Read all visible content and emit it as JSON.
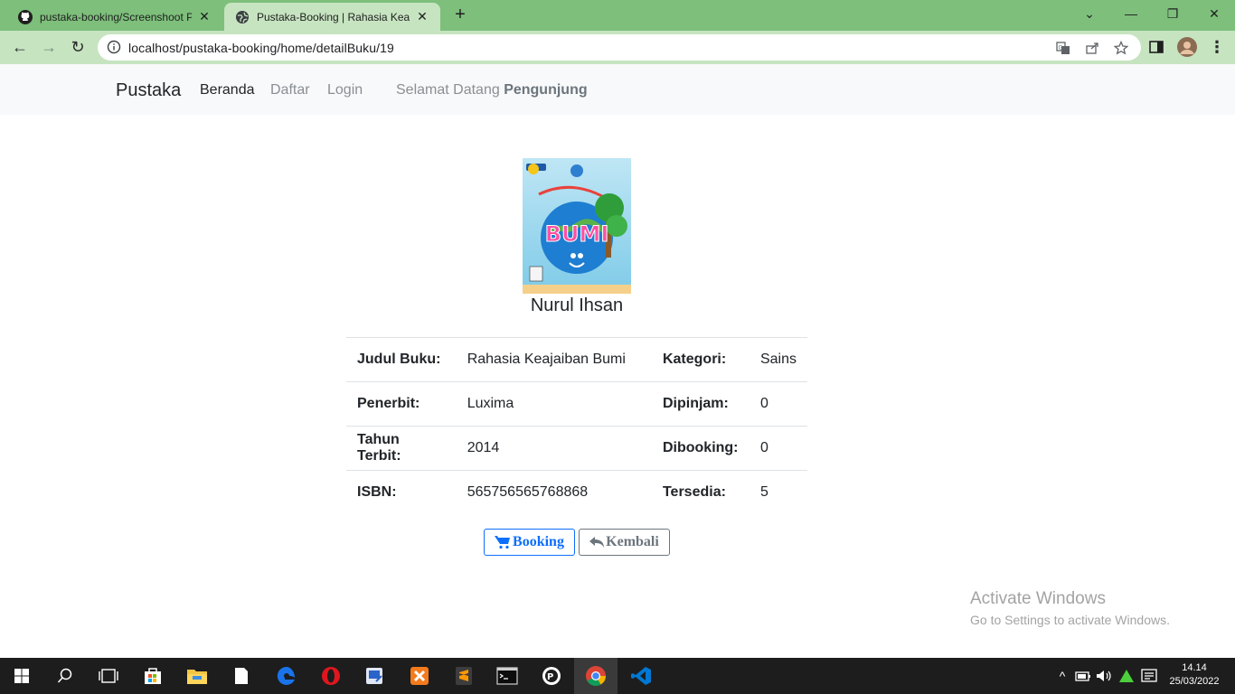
{
  "browser": {
    "tabs": [
      {
        "title": "pustaka-booking/Screenshoot Pr",
        "active": false,
        "icon": "github-icon"
      },
      {
        "title": "Pustaka-Booking | Rahasia Keajai",
        "active": true,
        "icon": "globe-icon"
      }
    ],
    "url": "localhost/pustaka-booking/home/detailBuku/19"
  },
  "navbar": {
    "brand": "Pustaka",
    "links": [
      "Beranda",
      "Daftar",
      "Login"
    ],
    "welcome_prefix": "Selamat Datang",
    "welcome_user": "Pengunjung"
  },
  "book": {
    "cover_text": "BUMI",
    "cover_subtitle": "Rahasia Keajaiban",
    "author": "Nurul Ihsan",
    "rows": [
      {
        "label1": "Judul Buku:",
        "value1": "Rahasia Keajaiban Bumi",
        "label2": "Kategori:",
        "value2": "Sains"
      },
      {
        "label1": "Penerbit:",
        "value1": "Luxima",
        "label2": "Dipinjam:",
        "value2": "0"
      },
      {
        "label1": "Tahun Terbit:",
        "value1": "2014",
        "label2": "Dibooking:",
        "value2": "0"
      },
      {
        "label1": "ISBN:",
        "value1": "565756565768868",
        "label2": "Tersedia:",
        "value2": "5"
      }
    ]
  },
  "actions": {
    "booking": "Booking",
    "kembali": "Kembali"
  },
  "watermark": {
    "line1": "Activate Windows",
    "line2": "Go to Settings to activate Windows."
  },
  "taskbar": {
    "time": "14.14",
    "date": "25/03/2022"
  },
  "colors": {
    "tabbar": "#7dbf7b",
    "toolbar": "#c6e4c0",
    "primary": "#0d6efd",
    "secondary": "#6c757d"
  }
}
